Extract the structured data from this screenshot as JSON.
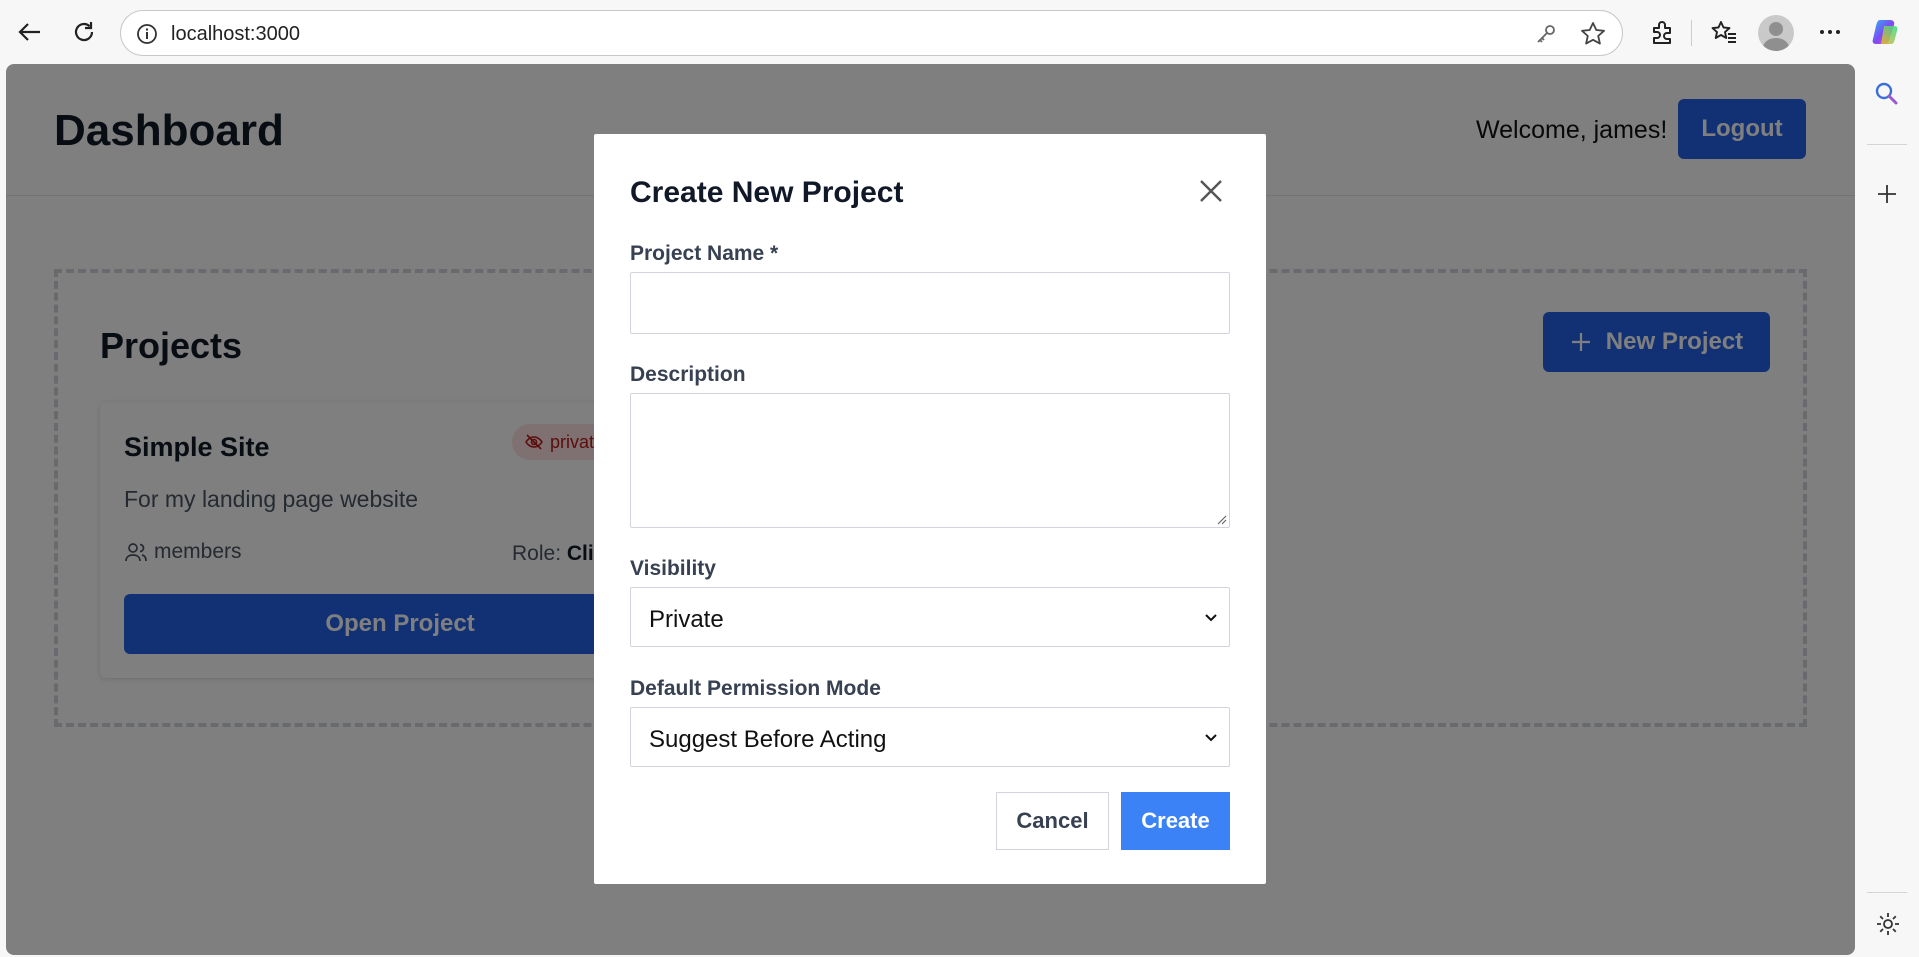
{
  "browser": {
    "url": "localhost:3000",
    "icons": [
      "back-icon",
      "reload-icon",
      "info-icon",
      "key-icon",
      "star-icon",
      "extensions-icon",
      "favorites-icon",
      "profile-icon",
      "more-icon",
      "copilot-icon",
      "search-icon",
      "add-icon",
      "settings-icon"
    ]
  },
  "header": {
    "title": "Dashboard",
    "welcome": "Welcome, james!",
    "logout_label": "Logout"
  },
  "projects": {
    "title": "Projects",
    "new_project_label": "New Project",
    "cards": [
      {
        "name": "Simple Site",
        "visibility_badge": "private",
        "description": "For my landing page website",
        "members_label": "members",
        "role_label": "Role:",
        "role_value": "Clie",
        "open_label": "Open Project"
      }
    ]
  },
  "modal": {
    "title": "Create New Project",
    "name_label": "Project Name *",
    "name_value": "",
    "description_label": "Description",
    "description_value": "",
    "visibility_label": "Visibility",
    "visibility_value": "Private",
    "permission_label": "Default Permission Mode",
    "permission_value": "Suggest Before Acting",
    "cancel_label": "Cancel",
    "create_label": "Create"
  },
  "colors": {
    "primary": "#2563eb",
    "create_button": "#3b82f6",
    "badge_bg": "#fee2e2",
    "badge_text": "#b91c1c"
  }
}
